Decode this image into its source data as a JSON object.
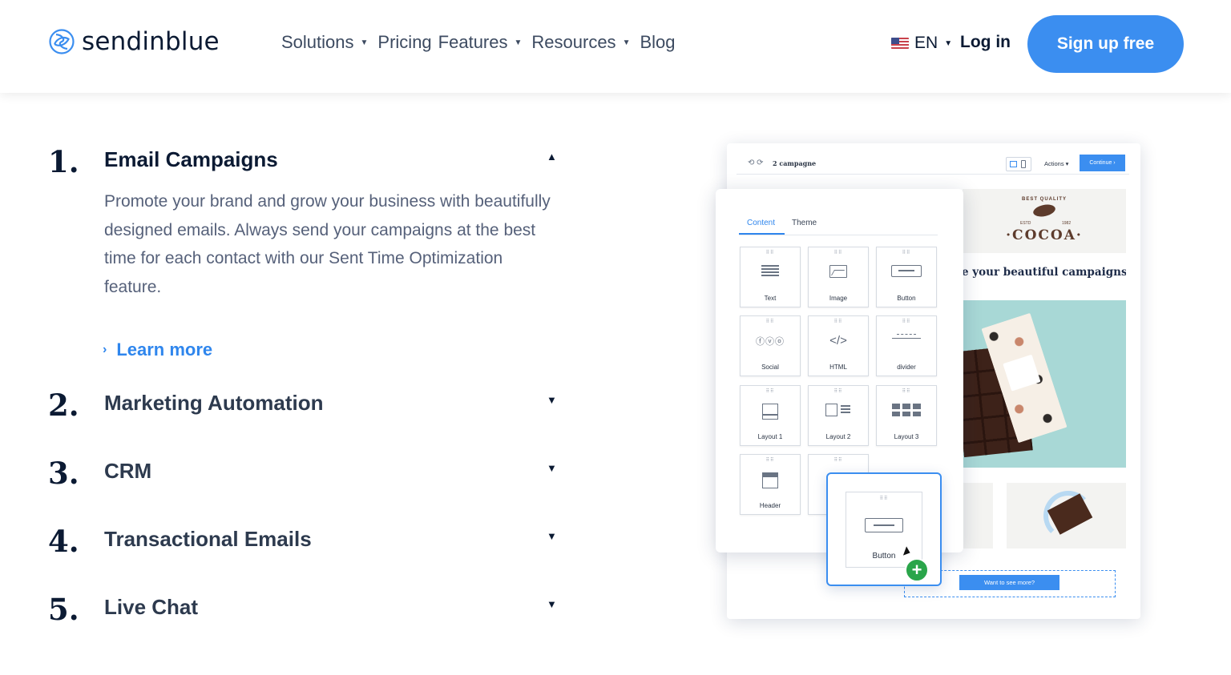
{
  "header": {
    "logo_text": "sendinblue",
    "nav": [
      {
        "label": "Solutions",
        "has_caret": true
      },
      {
        "label": "Pricing",
        "has_caret": false
      },
      {
        "label": "Features",
        "has_caret": true
      },
      {
        "label": "Resources",
        "has_caret": true
      },
      {
        "label": "Blog",
        "has_caret": false
      }
    ],
    "language": "EN",
    "login": "Log in",
    "signup": "Sign up free",
    "caret_glyph": "▼"
  },
  "accordion": {
    "items": [
      {
        "number": "1.",
        "title": "Email Campaigns",
        "expanded": true,
        "description": "Promote your brand and grow your business with beautifully designed emails. Always send your campaigns at the best time for each contact with our Sent Time Optimization feature.",
        "link": "Learn more",
        "toggle": "▲"
      },
      {
        "number": "2.",
        "title": "Marketing Automation",
        "expanded": false,
        "toggle": "▼"
      },
      {
        "number": "3.",
        "title": "CRM",
        "expanded": false,
        "toggle": "▼"
      },
      {
        "number": "4.",
        "title": "Transactional Emails",
        "expanded": false,
        "toggle": "▼"
      },
      {
        "number": "5.",
        "title": "Live Chat",
        "expanded": false,
        "toggle": "▼"
      }
    ]
  },
  "editor": {
    "campaign_name": "2 campagne",
    "actions": "Actions ▾",
    "continue": "Continue ›",
    "undo_redo": "⟲ ⟳",
    "tabs": [
      {
        "label": "Content",
        "active": true
      },
      {
        "label": "Theme",
        "active": false
      }
    ],
    "blocks": [
      {
        "name": "Text",
        "icon": "text-lines-icon"
      },
      {
        "name": "Image",
        "icon": "image-icon"
      },
      {
        "name": "Button",
        "icon": "button-icon"
      },
      {
        "name": "Social",
        "icon": "social-icons-icon"
      },
      {
        "name": "HTML",
        "icon": "code-icon"
      },
      {
        "name": "divider",
        "icon": "divider-icon"
      },
      {
        "name": "Layout 1",
        "icon": "layout-1-icon"
      },
      {
        "name": "Layout 2",
        "icon": "layout-2-icon"
      },
      {
        "name": "Layout 3",
        "icon": "layout-3-icon"
      },
      {
        "name": "Header",
        "icon": "header-icon"
      },
      {
        "name": "",
        "icon": "block-icon"
      }
    ],
    "grip": "⠿⠿",
    "social_glyphs": "ⓕⓥⓞ",
    "html_glyph": "</>",
    "drag_block": "Button",
    "plus": "+",
    "preview": {
      "cocoa_word": "·COCOA·",
      "best_quality": "BEST QUALITY",
      "est": "ESTD",
      "year": "1982",
      "headline": "e your beautiful campaigns",
      "cta": "Want to see more?"
    }
  },
  "colors": {
    "accent": "#3b8ef0",
    "navy": "#0b1a33",
    "plus_green": "#2aa54a"
  }
}
